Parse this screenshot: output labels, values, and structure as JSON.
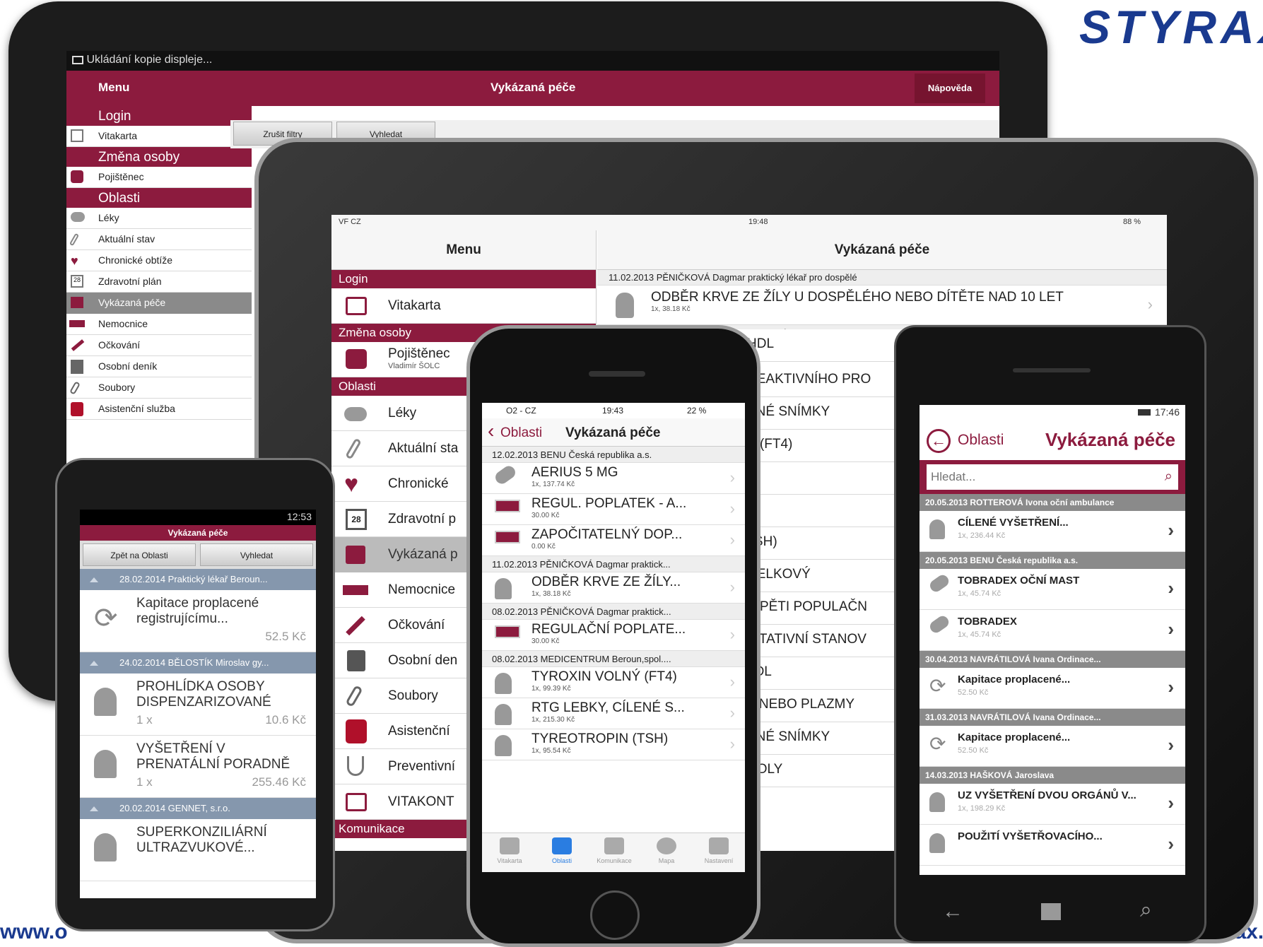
{
  "brand": {
    "logo": "STYRAX",
    "url_left": "www.o",
    "url_right": "yrax.c",
    "color": "#1a3a8f"
  },
  "accent": "#8c1b3e",
  "android_tablet": {
    "status": "Ukládání kopie displeje...",
    "menu_label": "Menu",
    "title": "Vykázaná péče",
    "help_button": "Nápověda",
    "filter_buttons": [
      "Zrušit filtry",
      "Vyhledat"
    ],
    "sections": [
      {
        "header": "Login",
        "items": [
          "Vitakarta"
        ]
      },
      {
        "header": "Změna osoby",
        "items": [
          "Pojištěnec"
        ]
      },
      {
        "header": "Oblasti",
        "items": [
          "Léky",
          "Aktuální stav",
          "Chronické obtíže",
          "Zdravotní plán",
          "Vykázaná péče",
          "Nemocnice",
          "Očkování",
          "Osobní deník",
          "Soubory",
          "Asistenční služba"
        ]
      }
    ]
  },
  "ipad": {
    "status_left": "VF CZ",
    "status_time": "19:48",
    "status_right": "88 %",
    "menu_title": "Menu",
    "title": "Vykázaná péče",
    "sections": {
      "login": "Login",
      "change": "Změna osoby",
      "areas": "Oblasti",
      "comm": "Komunikace"
    },
    "menu_items": [
      {
        "label": "Vitakarta",
        "sub": ""
      },
      {
        "label": "Pojištěnec",
        "sub": "Vladimír ŠOLC"
      },
      {
        "label": "Léky",
        "sub": ""
      },
      {
        "label": "Aktuální sta",
        "sub": ""
      },
      {
        "label": "Chronické",
        "sub": ""
      },
      {
        "label": "Zdravotní p",
        "sub": ""
      },
      {
        "label": "Vykázaná p",
        "sub": ""
      },
      {
        "label": "Nemocnice",
        "sub": ""
      },
      {
        "label": "Očkování",
        "sub": ""
      },
      {
        "label": "Osobní den",
        "sub": ""
      },
      {
        "label": "Soubory",
        "sub": ""
      },
      {
        "label": "Asistenční",
        "sub": ""
      },
      {
        "label": "Preventivní",
        "sub": ""
      },
      {
        "label": "VITAKONT",
        "sub": ""
      }
    ],
    "group1": "11.02.2013 PĚNIČKOVÁ Dagmar praktický lékař pro dospělé",
    "item1_title": "ODBĚR KRVE ZE ŽÍLY U DOSPĚLÉHO NEBO DÍTĚTE NAD 10 LET",
    "item1_sub": "1x, 38.18 Kč",
    "group2": "UM Beroun,spol.s r.o.",
    "right_items": [
      "HDL",
      "REAKTIVNÍHO PRO",
      "ENÉ SNÍMKY",
      "Ý (FT4)",
      "(TSH)",
      "CELKOVÝ",
      "S PĚTI POPULAČN",
      "TITATIVNÍ STANOV",
      "LDL",
      "A NEBO PLAZMY",
      "ENÉ SNÍMKY",
      "ROLY"
    ]
  },
  "iphone": {
    "status_left": "O2 - CZ",
    "status_time": "19:43",
    "status_right": "22 %",
    "back": "Oblasti",
    "title": "Vykázaná péče",
    "rows": [
      {
        "type": "group",
        "text": "12.02.2013 BENU Česká republika a.s."
      },
      {
        "type": "item",
        "title": "AERIUS 5 MG",
        "sub": "1x, 137.74 Kč",
        "icon": "pills"
      },
      {
        "type": "item",
        "title": "REGUL. POPLATEK - A...",
        "sub": "30.00 Kč",
        "icon": "card"
      },
      {
        "type": "item",
        "title": "ZAPOČITATELNÝ DOP...",
        "sub": "0.00 Kč",
        "icon": "card"
      },
      {
        "type": "group",
        "text": "11.02.2013 PĚNIČKOVÁ Dagmar praktick..."
      },
      {
        "type": "item",
        "title": "ODBĚR KRVE ZE ŽÍLY...",
        "sub": "1x, 38.18 Kč",
        "icon": "doctor"
      },
      {
        "type": "group",
        "text": "08.02.2013 PĚNIČKOVÁ Dagmar praktick..."
      },
      {
        "type": "item",
        "title": "REGULAČNÍ POPLATE...",
        "sub": "30.00 Kč",
        "icon": "card"
      },
      {
        "type": "group",
        "text": "08.02.2013 MEDICENTRUM Beroun,spol...."
      },
      {
        "type": "item",
        "title": "TYROXIN VOLNÝ (FT4)",
        "sub": "1x, 99.39 Kč",
        "icon": "doctor"
      },
      {
        "type": "item",
        "title": "RTG LEBKY, CÍLENÉ S...",
        "sub": "1x, 215.30 Kč",
        "icon": "doctor"
      },
      {
        "type": "item",
        "title": "TYREOTROPIN (TSH)",
        "sub": "1x, 95.54 Kč",
        "icon": "doctor"
      }
    ],
    "tabs": [
      "Vitakarta",
      "Oblasti",
      "Komunikace",
      "Mapa",
      "Nastavení"
    ]
  },
  "android_phone": {
    "status_time": "12:53",
    "title": "Vykázaná péče",
    "buttons": [
      "Zpět na Oblasti",
      "Vyhledat"
    ],
    "rows": [
      {
        "type": "group",
        "text": "28.02.2014  Praktický lékař Beroun..."
      },
      {
        "type": "item",
        "title": "Kapitace proplacené registrujícímu...",
        "qty": "",
        "price": "52.5 Kč",
        "icon": "refresh"
      },
      {
        "type": "group",
        "text": "24.02.2014  BĚLOSTÍK Miroslav gy..."
      },
      {
        "type": "item",
        "title": "PROHLÍDKA OSOBY DISPENZARIZOVANÉ",
        "qty": "1 x",
        "price": "10.6 Kč",
        "icon": "doctor"
      },
      {
        "type": "item",
        "title": "VYŠETŘENÍ V PRENATÁLNÍ PORADNĚ",
        "qty": "1 x",
        "price": "255.46 Kč",
        "icon": "doctor"
      },
      {
        "type": "group",
        "text": "20.02.2014  GENNET, s.r.o."
      },
      {
        "type": "item",
        "title": "SUPERKONZILIÁRNÍ ULTRAZVUKOVÉ...",
        "qty": "",
        "price": "",
        "icon": "doctor"
      }
    ]
  },
  "windows_phone": {
    "status_time": "17:46",
    "back": "Oblasti",
    "title": "Vykázaná péče",
    "search_placeholder": "Hledat...",
    "rows": [
      {
        "type": "group",
        "text": "20.05.2013 ROTTEROVÁ Ivona oční ambulance"
      },
      {
        "type": "item",
        "title": "CÍLENÉ VYŠETŘENÍ...",
        "sub": "1x, 236.44 Kč",
        "icon": "doctor"
      },
      {
        "type": "group",
        "text": "20.05.2013 BENU Česká republika a.s."
      },
      {
        "type": "item",
        "title": "TOBRADEX OČNÍ MAST",
        "sub": "1x, 45.74 Kč",
        "icon": "pills"
      },
      {
        "type": "item",
        "title": "TOBRADEX",
        "sub": "1x, 45.74 Kč",
        "icon": "pills"
      },
      {
        "type": "group",
        "text": "30.04.2013 NAVRÁTILOVÁ Ivana Ordinace..."
      },
      {
        "type": "item",
        "title": "Kapitace proplacené...",
        "sub": "52.50 Kč",
        "icon": "refresh"
      },
      {
        "type": "group",
        "text": "31.03.2013 NAVRÁTILOVÁ Ivana Ordinace..."
      },
      {
        "type": "item",
        "title": "Kapitace proplacené...",
        "sub": "52.50 Kč",
        "icon": "refresh"
      },
      {
        "type": "group",
        "text": "14.03.2013 HAŠKOVÁ Jaroslava"
      },
      {
        "type": "item",
        "title": "UZ VYŠETŘENÍ DVOU ORGÁNŮ V...",
        "sub": "1x, 198.29 Kč",
        "icon": "doctor"
      },
      {
        "type": "item",
        "title": "POUŽITÍ VYŠETŘOVACÍHO...",
        "sub": "",
        "icon": "doctor"
      }
    ]
  }
}
